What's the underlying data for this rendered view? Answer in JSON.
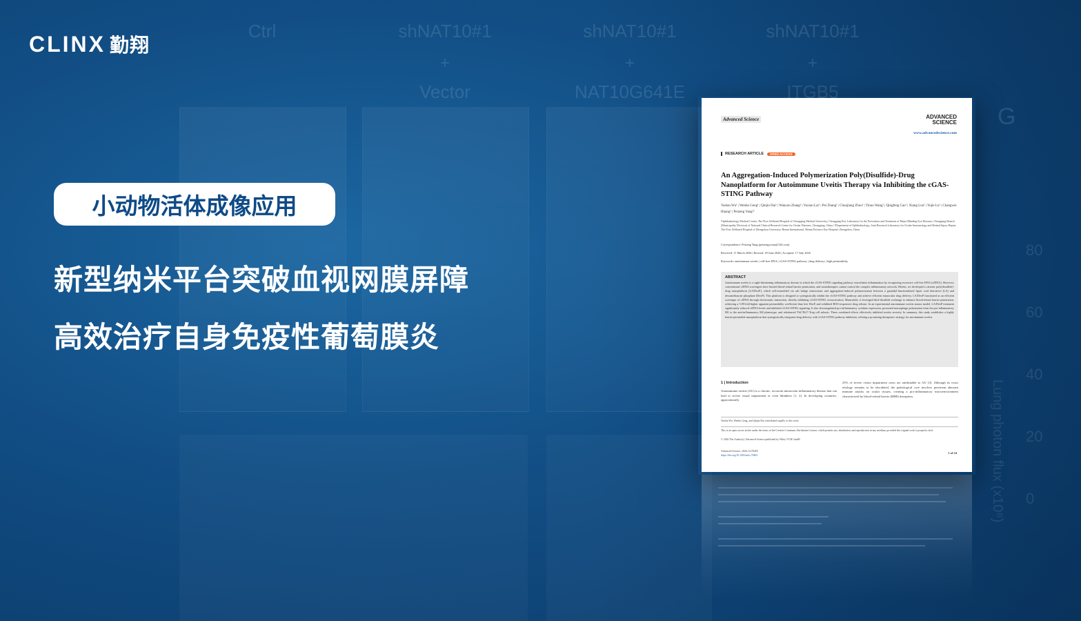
{
  "logo": {
    "wordmark": "CLINX",
    "chinese": "勤翔"
  },
  "tag": "小动物活体成像应用",
  "headline": {
    "line1": "新型纳米平台突破血视网膜屏障",
    "line2": "高效治疗自身免疫性葡萄膜炎"
  },
  "background_figure": {
    "columns": [
      {
        "line1": "Ctrl",
        "line2": "",
        "line3": ""
      },
      {
        "line1": "shNAT10#1",
        "line2": "+",
        "line3": "Vector"
      },
      {
        "line1": "shNAT10#1",
        "line2": "+",
        "line3": "NAT10G641E"
      },
      {
        "line1": "shNAT10#1",
        "line2": "+",
        "line3": "ITGB5"
      }
    ],
    "panel_letter": "G",
    "axis_label": "Lung photon flux (x10⁸)",
    "axis_ticks": [
      "80",
      "60",
      "40",
      "20",
      "0"
    ]
  },
  "paper": {
    "journal": "Advanced Science",
    "brand_line1": "ADVANCED",
    "brand_line2": "SCIENCE",
    "url": "www.advancedscience.com",
    "article_type": "RESEARCH ARTICLE",
    "badge": "OPEN ACCESS",
    "title": "An Aggregation-Induced Polymerization Poly(Disulfide)-Drug Nanoplatform for Autoimmune Uveitis Therapy via Inhibiting the cGAS-STING Pathway",
    "authors": "Yuelan Wu¹ | Wenbo Geng¹ | Qinjin Dai¹ | Wanyun Zhang¹ | Yuxian Lai¹ | Pei Zhang¹ | Chunjiang Zhou¹ | Yinuo Wang¹ | Qingfeng Cao¹ | Xiang Luo¹ | Yujie Lu¹ | Changwei Huang¹ | Peizeng Yang¹²",
    "affiliations": "¹Ophthalmology Medical Center, The First Affiliated Hospital of Chongqing Medical University, Chongqing Key Laboratory for the Prevention and Treatment of Major Blinding Eye Diseases, Chongqing Branch (Municipality Division) of National Clinical Research Center for Ocular Diseases, Chongqing, China | ²Department of Ophthalmology, Joint Research Laboratory for Ocular Immunology and Retinal Injury Repair, The First Affiliated Hospital of Zhengzhou University, Henan International, Henan Province Eye Hospital, Zhengzhou, China",
    "correspondence": "Correspondence: Peizeng Yang (peizengycmu@126.com)",
    "dates": "Received: 11 March 2026 | Revised: 29 June 2026 | Accepted: 17 July 2026",
    "keywords": "Keywords: autoimmune uveitis | cell-free DNA | cGAS-STING pathway | drug delivery | high permeability",
    "abstract_head": "ABSTRACT",
    "abstract": "Autoimmune uveitis is a sight-threatening inflammatory disease in which the cGAS-STING signaling pathway exacerbates inflammation by recognizing excessive cell-free DNA (cfDNA). However, conventional cfDNA scavengers have limited blood-retinal barrier penetration, and monotherapies cannot control the complex inflammatory network. Herein, we developed a cationic poly(disulfide)-drug nanoplatform (LA/DexP), which self-assembled via salt bridge interactions and aggregation-induced polymerization between a guanidyl-functionalized lipoic acid derivative (LA) and dexamethasone phosphate (DexP). This platform is designed to synergistically inhibit the cGAS-STING pathway and achieve efficient intraocular drug delivery. LA/DexP functioned as an efficient scavenger of cfDNA through electrostatic interaction, thereby inhibiting cGAS-STING overactivation. Meanwhile, it leveraged thiol-disulfide exchange to enhance blood-retinal barrier penetration, achieving a 5.09-fold higher apparent permeability coefficient than free DexP, and exhibited ROS-responsive drug release. In an experimental autoimmune uveitis mouse model, LA/DexP treatment significantly reduced cfDNA levels and inhibited cGAS-STING signaling. It also downregulated pro-inflammatory cytokine expression, promoted macrophage polarization from the pro-inflammatory M1 to the anti-inflammatory M2 phenotype, and rebalanced Th1/Th17-Treg cell subsets. These combined effects effectively inhibited uveitis severity. In summary, this study establishes a highly barrier-permeable nanoplatform that synergistically integrates drug delivery with cGAS-STING pathway inhibition, offering a promising therapeutic strategy for autoimmune uveitis.",
    "intro_head": "1 | Introduction",
    "intro_left": "Autoimmune uveitis (AU) is a chronic, recurrent intraocular inflammatory disease that can lead to severe visual impairment or even blindness [1, 2]. In developing countries, approximately",
    "intro_right": "25% of severe vision impairment cases are attributable to AU [3]. Although its exact etiology remains to be elucidated, the pathological core involves persistent aberrant immune attacks on ocular tissues, creating a pro-inflammatory microenvironment characterized by blood-retinal barrier (BRB) disruption,",
    "footnote1": "Yuelan Wu, Wenbo Geng, and Qinjin Dai contributed equally to this work.",
    "footnote2": "This is an open access article under the terms of the Creative Commons Attribution License, which permits use, distribution and reproduction in any medium, provided the original work is properly cited.",
    "footnote3": "© 2026 The Author(s). Advanced Science published by Wiley-VCH GmbH",
    "citation": "Advanced Science, 2026; 0:e70403",
    "doi": "https://doi.org/10.1002/advs.70403",
    "page": "1 of 24"
  }
}
